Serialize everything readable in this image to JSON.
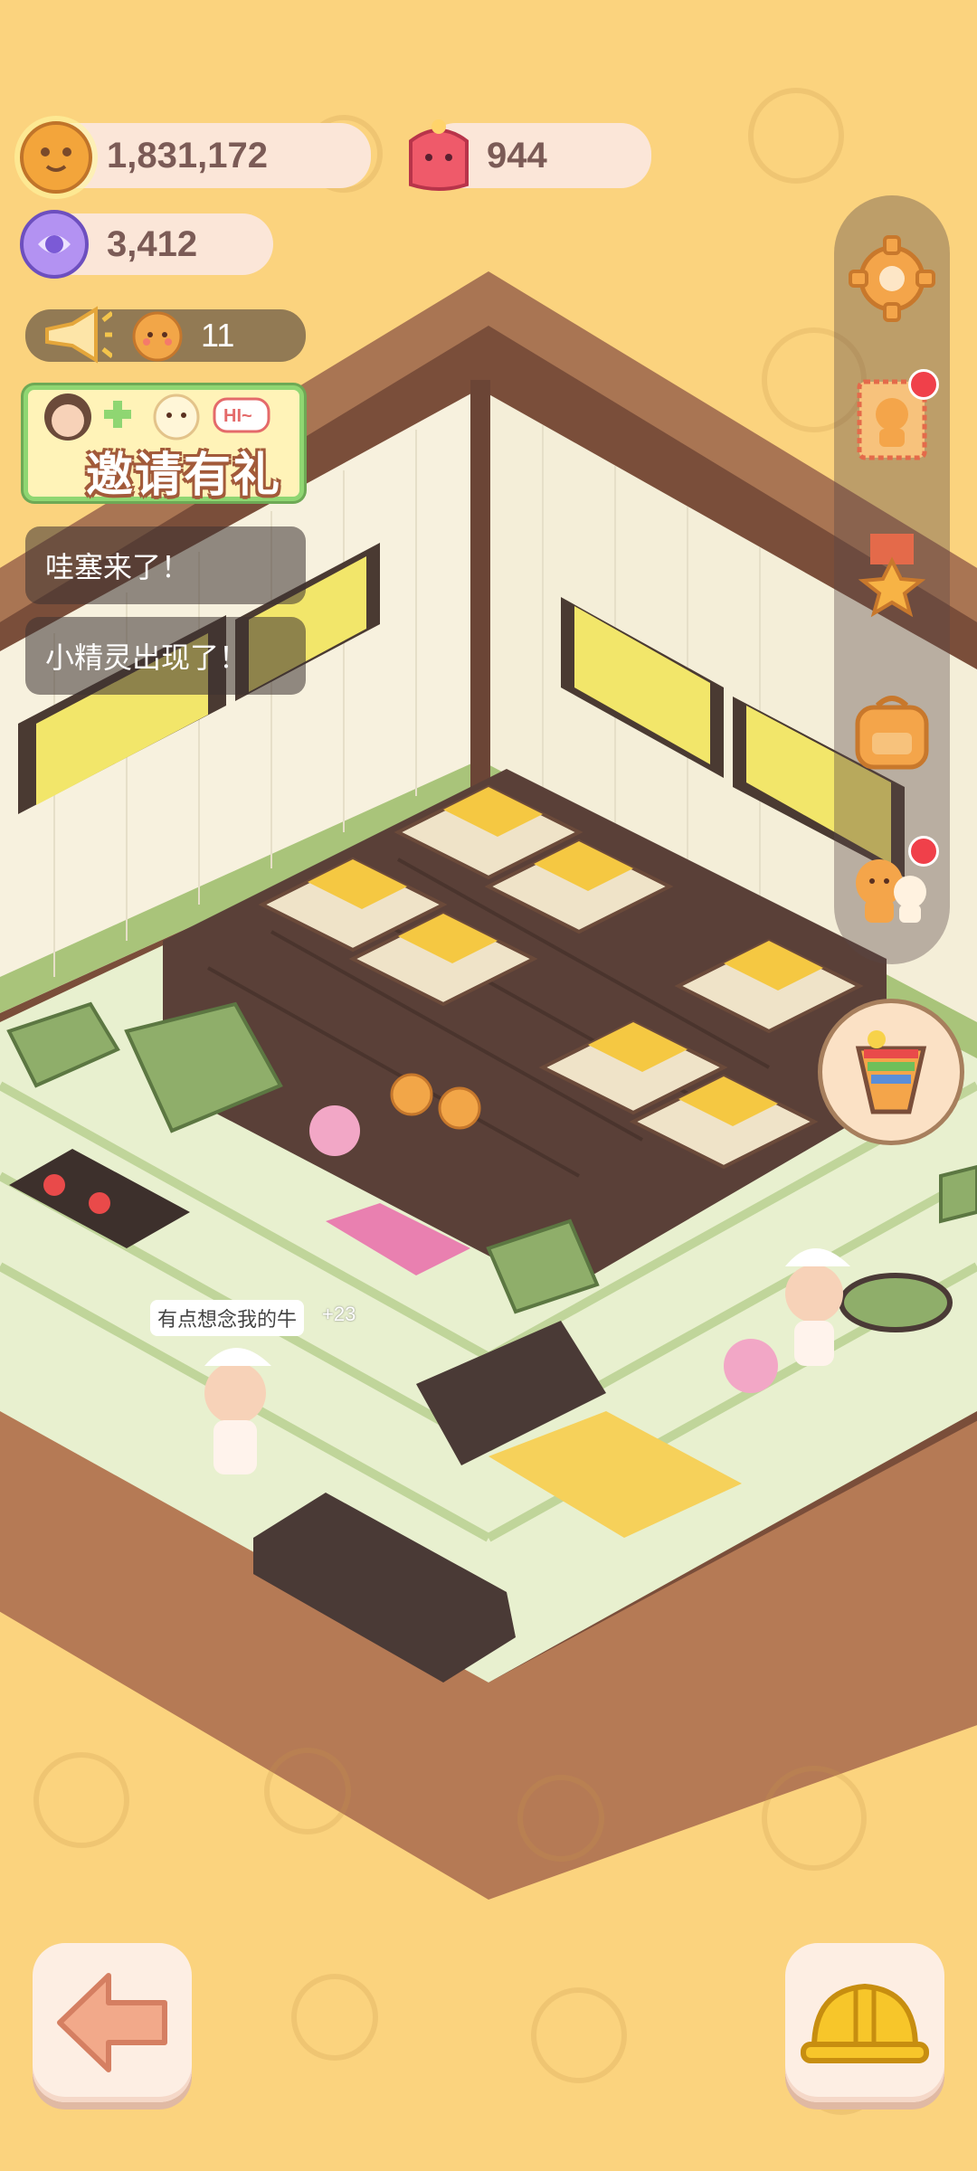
{
  "currencies": {
    "coins": "1,831,172",
    "gems": "944",
    "candy": "3,412"
  },
  "announcement": {
    "count": "11"
  },
  "invite": {
    "label": "邀请有礼",
    "badge_text": "HI~"
  },
  "toasts": [
    "哇塞来了！",
    "小精灵出现了！"
  ],
  "character": {
    "speech": "有点想念我的牛",
    "reward": "+23"
  },
  "side_menu": {
    "items": [
      "gear-icon",
      "gift-card-icon",
      "medal-icon",
      "backpack-icon",
      "friends-icon"
    ],
    "badges": [
      false,
      true,
      false,
      false,
      true
    ]
  },
  "bottom": {
    "left": "back-arrow-icon",
    "right": "hardhat-icon"
  },
  "colors": {
    "background": "#fbd37e",
    "pill": "#fbe6d8",
    "red_badge": "#f0404a"
  }
}
